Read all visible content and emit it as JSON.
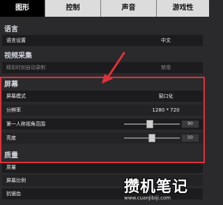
{
  "tabs": [
    {
      "label": "图形",
      "active": true
    },
    {
      "label": "控制",
      "active": false
    },
    {
      "label": "声音",
      "active": false
    },
    {
      "label": "游戏性",
      "active": false
    }
  ],
  "sections": {
    "language": {
      "title": "语言",
      "rows": [
        {
          "label": "语言设置",
          "value": "中文"
        }
      ]
    },
    "video_capture": {
      "title": "视频采集",
      "rows": [
        {
          "label": "精彩时刻自动录制",
          "value": "禁用"
        }
      ]
    },
    "screen": {
      "title": "屏幕",
      "rows": [
        {
          "label": "屏幕模式",
          "value": "窗口化"
        },
        {
          "label": "分辨率",
          "value": "1280 * 720"
        },
        {
          "label": "第一人称视角范围",
          "value": "90",
          "level": 0.45
        },
        {
          "label": "亮度",
          "value": "50",
          "level": 0.5
        }
      ]
    },
    "quality": {
      "title": "质量",
      "rows": [
        {
          "label": "质量",
          "value": ""
        },
        {
          "label": "屏幕比例",
          "value": ""
        },
        {
          "label": "抗锯齿",
          "value": ""
        }
      ]
    }
  },
  "watermark": {
    "title": "攒机笔记",
    "url": "www.cuanjibiji.com"
  },
  "colors": {
    "highlight": "#e0313a",
    "active_tab": "#000000",
    "section_title": "#cfd2da"
  }
}
